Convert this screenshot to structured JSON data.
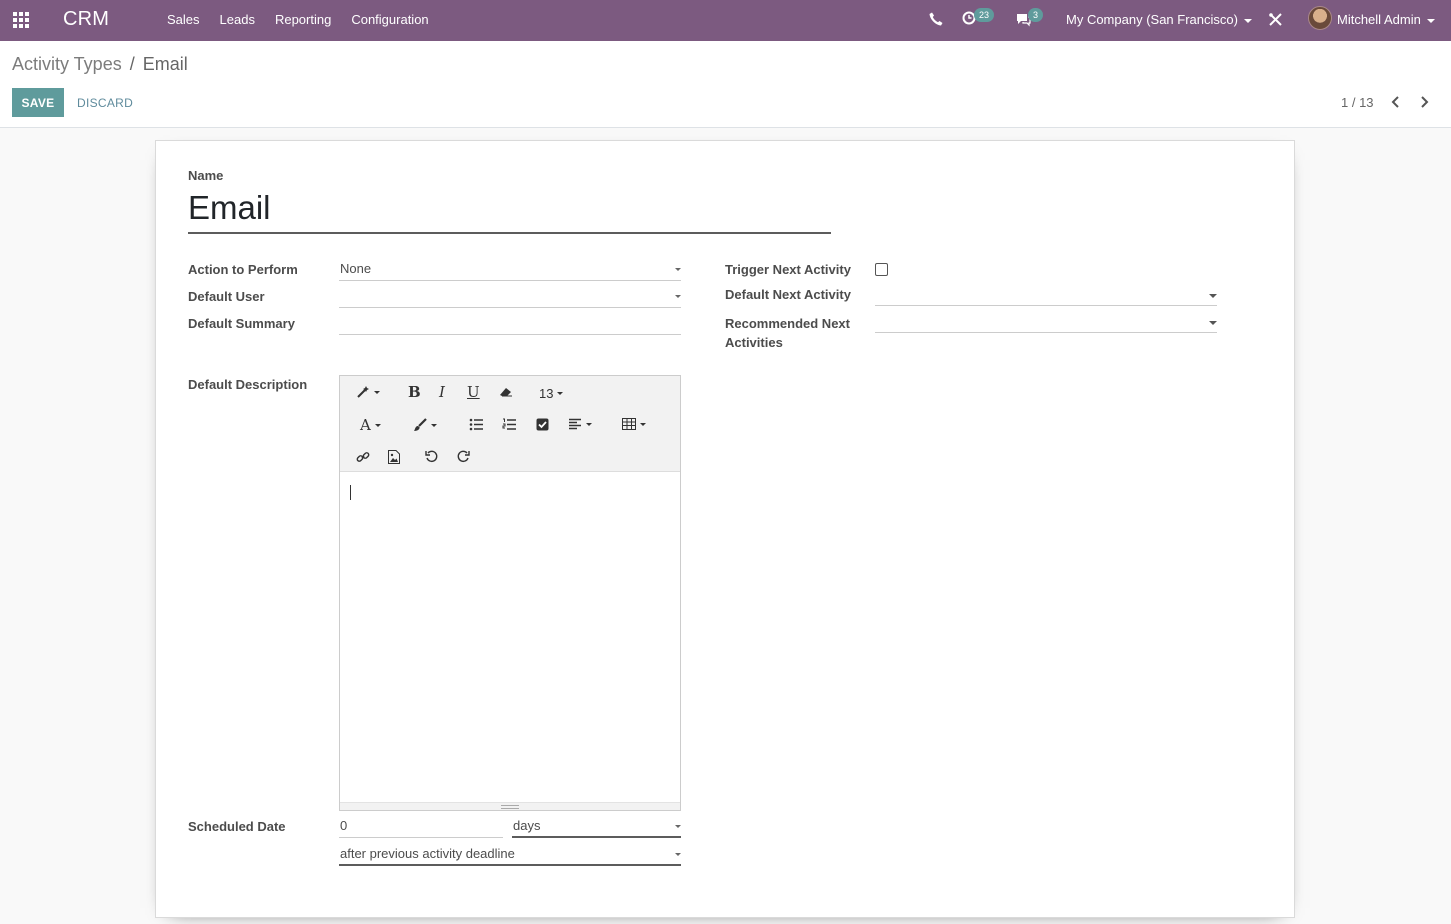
{
  "navbar": {
    "brand": "CRM",
    "menu": [
      "Sales",
      "Leads",
      "Reporting",
      "Configuration"
    ],
    "activity_count": "23",
    "message_count": "3",
    "company": "My Company (San Francisco)",
    "user": "Mitchell Admin",
    "bg_color": "#7c5a80"
  },
  "breadcrumb": {
    "parent": "Activity Types",
    "separator": "/",
    "current": "Email"
  },
  "actions": {
    "save": "SAVE",
    "discard": "DISCARD"
  },
  "pager": {
    "value": "1 / 13"
  },
  "form": {
    "name_label": "Name",
    "name_value": "Email",
    "action_label": "Action to Perform",
    "action_value": "None",
    "default_user_label": "Default User",
    "default_user_value": "",
    "default_summary_label": "Default Summary",
    "default_summary_value": "",
    "trigger_label": "Trigger Next Activity",
    "trigger_checked": false,
    "default_next_label": "Default Next Activity",
    "default_next_value": "",
    "recommended_label": "Recommended Next Activities",
    "recommended_value": "",
    "description_label": "Default Description",
    "editor_font_size": "13",
    "scheduled_label": "Scheduled Date",
    "scheduled_value": "0",
    "scheduled_unit": "days",
    "scheduled_from": "after previous activity deadline"
  },
  "accent_color": "#5f9b9c"
}
